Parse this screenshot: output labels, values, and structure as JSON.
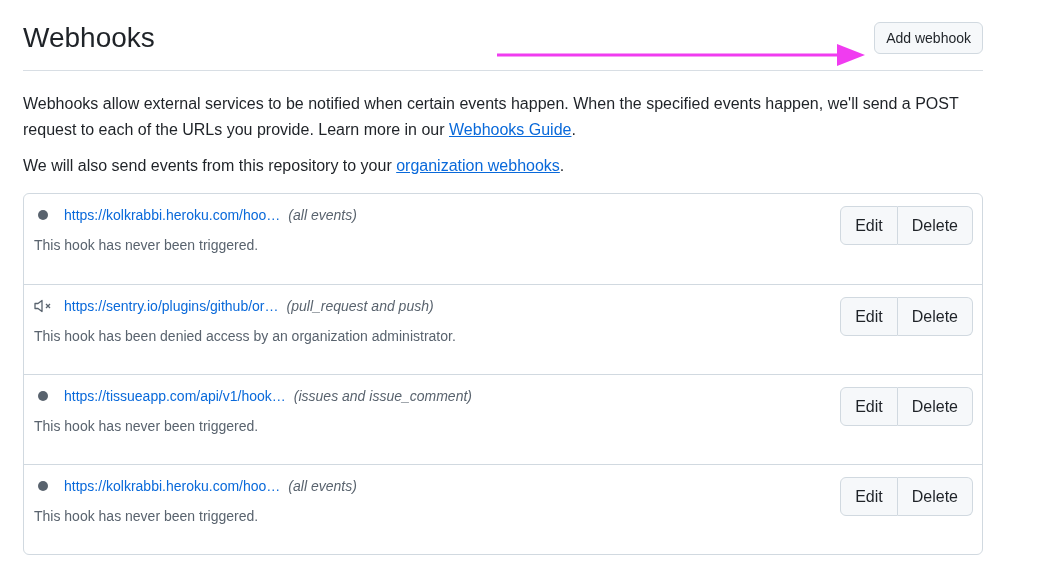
{
  "header": {
    "title": "Webhooks",
    "add_button": "Add webhook"
  },
  "intro": {
    "text": "Webhooks allow external services to be notified when certain events happen. When the specified events happen, we'll send a POST request to each of the URLs you provide. Learn more in our ",
    "link": "Webhooks Guide",
    "after": "."
  },
  "org_note": {
    "text": "We will also send events from this repository to your ",
    "link": "organization webhooks",
    "after": "."
  },
  "hooks": [
    {
      "kind": "inactive",
      "url": "https://kolkrabbi.heroku.com/hoo…",
      "events": "(all events)",
      "status": "This hook has never been triggered.",
      "edit": "Edit",
      "delete": "Delete"
    },
    {
      "kind": "muted",
      "url": "https://sentry.io/plugins/github/or…",
      "events": "(pull_request and push)",
      "status": "This hook has been denied access by an organization administrator.",
      "edit": "Edit",
      "delete": "Delete"
    },
    {
      "kind": "inactive",
      "url": "https://tissueapp.com/api/v1/hook…",
      "events": "(issues and issue_comment)",
      "status": "This hook has never been triggered.",
      "edit": "Edit",
      "delete": "Delete"
    },
    {
      "kind": "inactive",
      "url": "https://kolkrabbi.heroku.com/hoo…",
      "events": "(all events)",
      "status": "This hook has never been triggered.",
      "edit": "Edit",
      "delete": "Delete"
    }
  ]
}
